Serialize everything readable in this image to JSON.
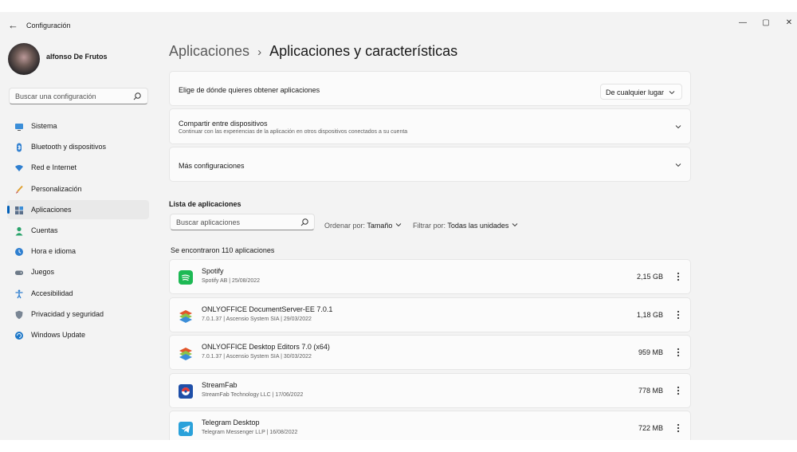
{
  "window": {
    "title": "Configuración",
    "back_glyph": "←",
    "minimize_glyph": "—",
    "maximize_glyph": "▢",
    "close_glyph": "✕"
  },
  "profile": {
    "name": "alfonso De Frutos"
  },
  "search": {
    "placeholder": "Buscar una configuración",
    "icon": "search-icon"
  },
  "sidebar": {
    "items": [
      {
        "label": "Sistema",
        "icon": "monitor-icon",
        "active": false
      },
      {
        "label": "Bluetooth y dispositivos",
        "icon": "bluetooth-icon",
        "active": false
      },
      {
        "label": "Red e Internet",
        "icon": "wifi-icon",
        "active": false
      },
      {
        "label": "Personalización",
        "icon": "brush-icon",
        "active": false
      },
      {
        "label": "Aplicaciones",
        "icon": "apps-icon",
        "active": true
      },
      {
        "label": "Cuentas",
        "icon": "person-icon",
        "active": false
      },
      {
        "label": "Hora e idioma",
        "icon": "globe-clock-icon",
        "active": false
      },
      {
        "label": "Juegos",
        "icon": "gamepad-icon",
        "active": false
      },
      {
        "label": "Accesibilidad",
        "icon": "accessibility-icon",
        "active": false
      },
      {
        "label": "Privacidad y seguridad",
        "icon": "shield-icon",
        "active": false
      },
      {
        "label": "Windows Update",
        "icon": "update-icon",
        "active": false
      }
    ]
  },
  "header": {
    "breadcrumb_parent": "Aplicaciones",
    "breadcrumb_separator": "›",
    "breadcrumb_current": "Aplicaciones y características"
  },
  "settings": {
    "source": {
      "label": "Elige de dónde quieres obtener aplicaciones",
      "value": "De cualquier lugar"
    },
    "share": {
      "label": "Compartir entre dispositivos",
      "description": "Continuar con las experiencias de la aplicación en otros dispositivos conectados a su cuenta"
    },
    "more": {
      "label": "Más configuraciones"
    }
  },
  "app_list": {
    "title": "Lista de aplicaciones",
    "search_placeholder": "Buscar aplicaciones",
    "sort_label": "Ordenar por:",
    "sort_value": "Tamaño",
    "filter_label": "Filtrar por:",
    "filter_value": "Todas las unidades",
    "count_text": "Se encontraron 110 aplicaciones",
    "apps": [
      {
        "name": "Spotify",
        "meta": "Spotify AB  |  25/08/2022",
        "size": "2,15 GB",
        "icon": "spotify-icon"
      },
      {
        "name": "ONLYOFFICE DocumentServer-EE 7.0.1",
        "meta": "7.0.1.37  |  Ascensio System SIA  |  29/03/2022",
        "size": "1,18 GB",
        "icon": "onlyoffice-icon"
      },
      {
        "name": "ONLYOFFICE Desktop Editors 7.0 (x64)",
        "meta": "7.0.1.37  |  Ascensio System SIA  |  30/03/2022",
        "size": "959 MB",
        "icon": "onlyoffice-icon"
      },
      {
        "name": "StreamFab",
        "meta": "StreamFab Technology LLC  |  17/06/2022",
        "size": "778 MB",
        "icon": "streamfab-icon"
      },
      {
        "name": "Telegram Desktop",
        "meta": "Telegram Messenger LLP  |  16/08/2022",
        "size": "722 MB",
        "icon": "telegram-icon"
      }
    ]
  },
  "colors": {
    "accent": "#005fb8",
    "background": "#f3f3f3",
    "card": "#fbfbfb"
  }
}
